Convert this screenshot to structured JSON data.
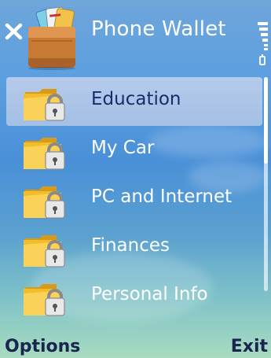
{
  "header": {
    "title": "Phone Wallet",
    "app_icon": "wallet-icon",
    "close_icon": "close-icon",
    "signal_icon": "signal-strength-icon"
  },
  "folders": [
    {
      "label": "Education",
      "selected": true,
      "icon": "locked-folder-icon"
    },
    {
      "label": "My Car",
      "selected": false,
      "icon": "locked-folder-icon"
    },
    {
      "label": "PC and Internet",
      "selected": false,
      "icon": "locked-folder-icon"
    },
    {
      "label": "Finances",
      "selected": false,
      "icon": "locked-folder-icon"
    },
    {
      "label": "Personal Info",
      "selected": false,
      "icon": "locked-folder-icon"
    }
  ],
  "softkeys": {
    "left": "Options",
    "right": "Exit"
  },
  "colors": {
    "selected_text": "#1a2a6c",
    "softkey_text": "#1a2450",
    "title_text": "#ffffff"
  }
}
